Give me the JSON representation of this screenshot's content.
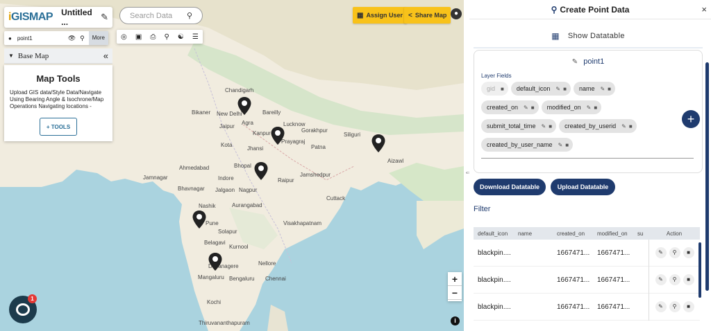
{
  "app": {
    "logo_prefix": "i",
    "logo_rest": "GISMAP",
    "map_title": "Untitled ..."
  },
  "search": {
    "placeholder": "Search Data"
  },
  "layer": {
    "name": "point1",
    "more_label": "More"
  },
  "basemap": {
    "label": "Base Map"
  },
  "map_tools": {
    "title": "Map Tools",
    "description": "Upload GIS data/Style Data/Navigate Using Bearing Angle & Isochrone/Map Operations Navigating locations -",
    "button": "+ TOOLS"
  },
  "header_buttons": {
    "assign_user": "Assign User",
    "share_map": "Share Map"
  },
  "zoom": {
    "in": "+",
    "out": "−"
  },
  "chat": {
    "badge": "1"
  },
  "map_labels": [
    "Chandigarh",
    "New Delhi",
    "Agra",
    "Bareilly",
    "Jaipur",
    "Bikaner",
    "Lucknow",
    "Kanpur",
    "Prayagraj",
    "Gorakhpur",
    "Patna",
    "Siliguri",
    "Kota",
    "Jhansi",
    "Ahmedabad",
    "Bhopal",
    "Indore",
    "Jamshedpur",
    "Nagpur",
    "Jamnagar",
    "Bhavnagar",
    "Jalgaon",
    "Raipur",
    "Cuttack",
    "Nashik",
    "Aurangabad",
    "Pune",
    "Solapur",
    "Visakhapatnam",
    "Belagavi",
    "Kurnool",
    "Nellore",
    "Chennai",
    "Bengaluru",
    "Mangaluru",
    "Thiruvananthapuram",
    "Aizawl",
    "Kochi",
    "Davanagere"
  ],
  "panel": {
    "title": "Create Point Data",
    "close": "×",
    "show_datatable": "Show Datatable",
    "layer_name": "point1",
    "layer_fields_label": "Layer Fields",
    "fields": [
      {
        "name": "gid",
        "dim": true
      },
      {
        "name": "default_icon",
        "dim": false
      },
      {
        "name": "name",
        "dim": false
      },
      {
        "name": "created_on",
        "dim": false
      },
      {
        "name": "modified_on",
        "dim": false
      },
      {
        "name": "submit_total_time",
        "dim": false
      },
      {
        "name": "created_by_userid",
        "dim": false
      },
      {
        "name": "created_by_user_name",
        "dim": false
      }
    ],
    "download_btn": "Download Datatable",
    "upload_btn": "Upload Datatable",
    "filter_label": "Filter",
    "table": {
      "headers": [
        "default_icon",
        "name",
        "created_on",
        "modified_on",
        "su",
        "Action"
      ],
      "rows": [
        [
          "blackpin....",
          "",
          "1667471...",
          "1667471...",
          ""
        ],
        [
          "blackpin....",
          "",
          "1667471...",
          "1667471...",
          ""
        ],
        [
          "blackpin....",
          "",
          "1667471...",
          "1667471...",
          ""
        ]
      ]
    }
  }
}
